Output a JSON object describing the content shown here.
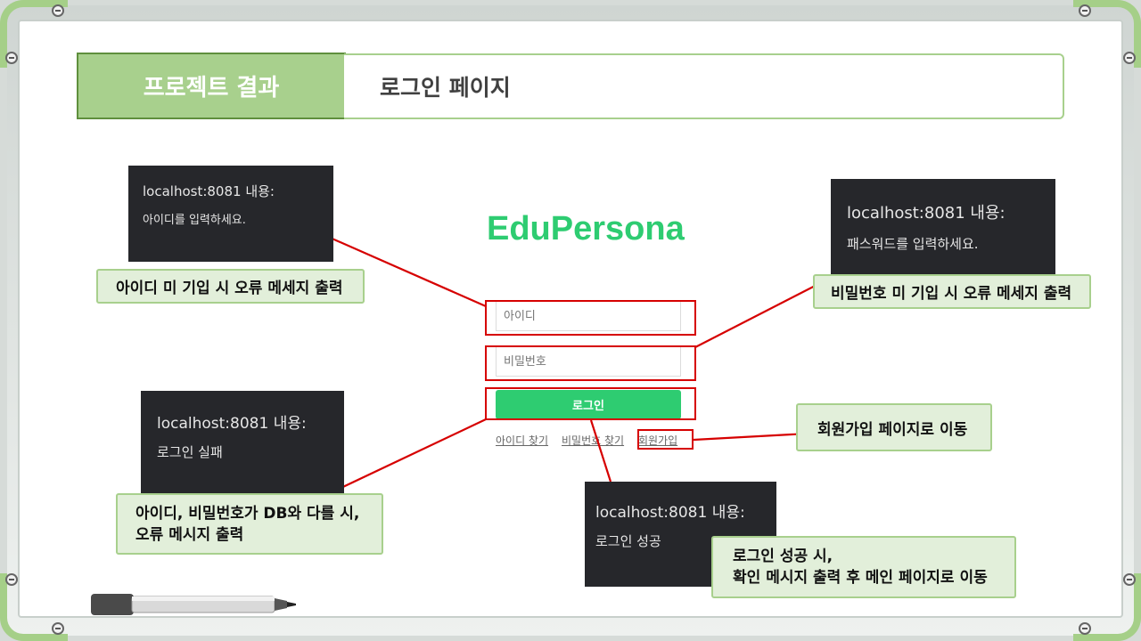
{
  "header": {
    "section_title": "프로젝트 결과",
    "page_title": "로그인 페이지"
  },
  "login": {
    "brand": "EduPersona",
    "id_placeholder": "아이디",
    "pw_placeholder": "비밀번호",
    "login_button": "로그인",
    "links": [
      "아이디 찾기",
      "비밀번호 찾기",
      "회원가입"
    ]
  },
  "dialogs": {
    "id_empty": {
      "title": "localhost:8081 내용:",
      "message": "아이디를 입력하세요."
    },
    "pw_empty": {
      "title": "localhost:8081 내용:",
      "message": "패스워드를 입력하세요."
    },
    "login_fail": {
      "title": "localhost:8081 내용:",
      "message": "로그인 실패"
    },
    "login_success": {
      "title": "localhost:8081 내용:",
      "message": "로그인 성공"
    }
  },
  "annotations": {
    "id_empty": "아이디 미 기입 시 오류 메세지 출력",
    "pw_empty": "비밀번호 미 기입 시 오류 메세지 출력",
    "signup": "회원가입 페이지로 이동",
    "fail_line1": "아이디, 비밀번호가 DB와 다를 시,",
    "fail_line2": "오류 메시지 출력",
    "success_line1": "로그인 성공 시,",
    "success_line2": "확인 메시지 출력 후 메인 페이지로 이동"
  },
  "colors": {
    "accent_green": "#a8d08d",
    "brand_green": "#2ecc71",
    "annotation_red": "#d60000",
    "dialog_bg": "#26272b"
  }
}
